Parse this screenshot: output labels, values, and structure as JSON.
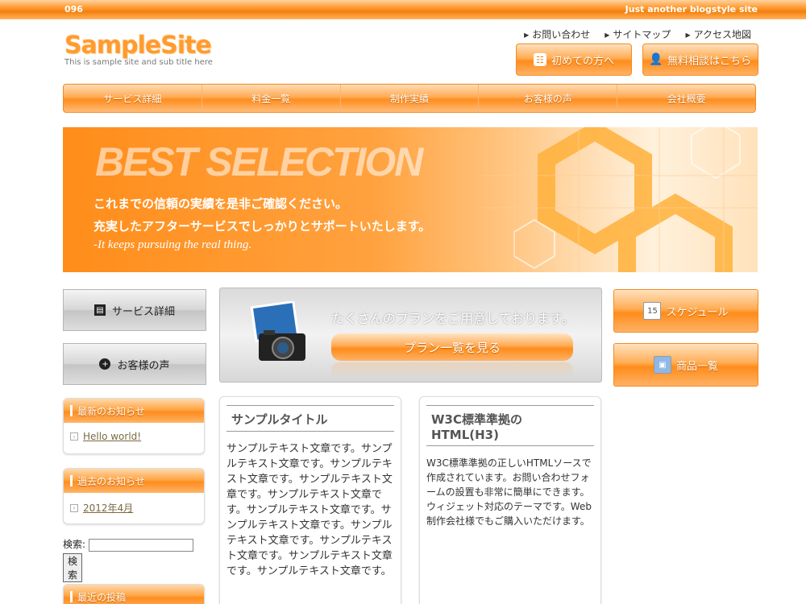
{
  "topbar": {
    "number": "096",
    "tagline": "Just another blogstyle site"
  },
  "logo": {
    "title": "SampleSite",
    "subtitle": "This is sample site and sub title here"
  },
  "toplinks": [
    "お問い合わせ",
    "サイトマップ",
    "アクセス地図"
  ],
  "header_buttons": {
    "first_time": "初めての方へ",
    "consult": "無料相談はこちら"
  },
  "nav": [
    "サービス詳細",
    "料金一覧",
    "制作実績",
    "お客様の声",
    "会社概要"
  ],
  "banner": {
    "headline": "BEST SELECTION",
    "line1": "これまでの信頼の実績を是非ご確認ください。",
    "line2": "充実したアフターサービスでしっかりとサポートいたします。",
    "line3": "-It keeps pursuing the real thing."
  },
  "left_buttons": {
    "service": "サービス詳細",
    "voice": "お客様の声"
  },
  "plan": {
    "text": "たくさんのプランをご用意しております。",
    "button": "プラン一覧を見る"
  },
  "right_buttons": {
    "schedule": "スケジュール",
    "products": "商品一覧",
    "calendar_day": "15"
  },
  "widgets": {
    "news": {
      "title": "最新のお知らせ",
      "items": [
        "Hello world!"
      ]
    },
    "archive": {
      "title": "過去のお知らせ",
      "items": [
        "2012年4月"
      ]
    },
    "recent": {
      "title": "最近の投稿"
    }
  },
  "search": {
    "label": "検索:",
    "button": "検索"
  },
  "card1": {
    "title": "サンプルタイトル",
    "body": "サンプルテキスト文章です。サンプルテキスト文章です。サンプルテキスト文章です。サンプルテキスト文章です。サンプルテキスト文章です。サンプルテキスト文章です。サンプルテキスト文章です。サンプルテキスト文章です。サンプルテキスト文章です。サンプルテキスト文章です。サンプルテキスト文章です。"
  },
  "card2": {
    "title": "W3C標準準拠のHTML(H3)",
    "body": "W3C標準準拠の正しいHTMLソースで作成されています。お問い合わせフォームの設置も非常に簡単にできます。ウィジェット対応のテーマです。Web制作会社様でもご購入いただけます。"
  },
  "colors": {
    "accent": "#ff8d1d",
    "accent_light": "#ffd9ae"
  }
}
